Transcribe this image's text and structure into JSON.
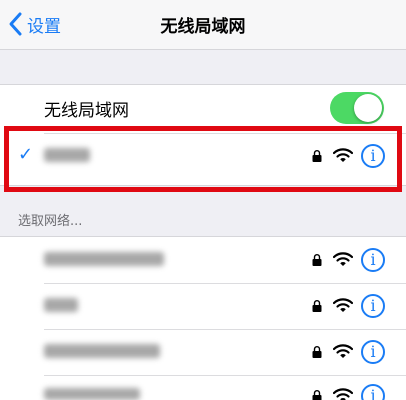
{
  "navbar": {
    "back_label": "设置",
    "title": "无线局域网"
  },
  "wifi_toggle": {
    "label": "无线局域网",
    "state": "on",
    "color": "#4cd964"
  },
  "connected_network": {
    "selected": true,
    "icons": [
      "check-icon",
      "lock-icon",
      "wifi-icon",
      "info-icon"
    ]
  },
  "section": {
    "header": "选取网络..."
  },
  "networks": [
    {
      "icons": [
        "lock-icon",
        "wifi-icon",
        "info-icon"
      ]
    },
    {
      "icons": [
        "lock-icon",
        "wifi-icon",
        "info-icon"
      ]
    },
    {
      "icons": [
        "lock-icon",
        "wifi-icon",
        "info-icon"
      ]
    },
    {
      "icons": [
        "lock-icon",
        "wifi-icon",
        "info-icon"
      ]
    }
  ],
  "colors": {
    "accent": "#1a7cf5",
    "highlight_border": "#e00912",
    "background": "#efeff4"
  }
}
